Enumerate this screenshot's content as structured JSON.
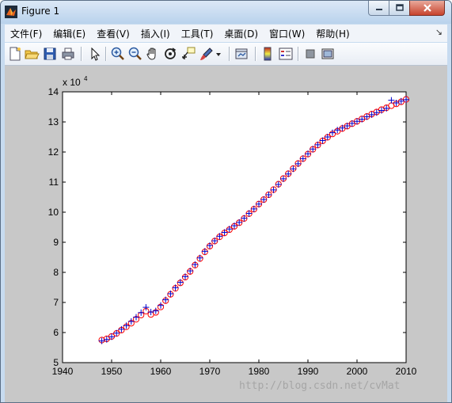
{
  "window": {
    "title": "Figure 1"
  },
  "menu": [
    "文件(F)",
    "编辑(E)",
    "查看(V)",
    "插入(I)",
    "工具(T)",
    "桌面(D)",
    "窗口(W)",
    "帮助(H)"
  ],
  "toolbar": {
    "items": [
      "new-figure-icon",
      "open-file-icon",
      "save-icon",
      "print-icon",
      "pointer-icon",
      "zoom-in-icon",
      "zoom-out-icon",
      "pan-hand-icon",
      "rotate-3d-icon",
      "data-cursor-icon",
      "brush-icon",
      "link-plot-icon",
      "colorbar-icon",
      "legend-icon",
      "hide-plot-tools-icon",
      "show-plot-tools-icon"
    ]
  },
  "colors": {
    "axes_background": "#ffffff",
    "figure_background": "#c8c8c8",
    "series_red": "#ff0000",
    "series_blue": "#0000cc"
  },
  "watermark": "http://blog.csdn.net/cvMat",
  "chart_data": {
    "type": "scatter",
    "title": "",
    "xlabel": "",
    "ylabel": "",
    "xlim": [
      1940,
      2010
    ],
    "ylim": [
      5,
      14
    ],
    "y_exponent_label": "x 10",
    "y_exponent_power": "4",
    "xticks": [
      1940,
      1950,
      1960,
      1970,
      1980,
      1990,
      2000,
      2010
    ],
    "yticks": [
      5,
      6,
      7,
      8,
      9,
      10,
      11,
      12,
      13,
      14
    ],
    "grid": false,
    "legend": "none",
    "x": [
      1948,
      1949,
      1950,
      1951,
      1952,
      1953,
      1954,
      1955,
      1956,
      1957,
      1958,
      1959,
      1960,
      1961,
      1962,
      1963,
      1964,
      1965,
      1966,
      1967,
      1968,
      1969,
      1970,
      1971,
      1972,
      1973,
      1974,
      1975,
      1976,
      1977,
      1978,
      1979,
      1980,
      1981,
      1982,
      1983,
      1984,
      1985,
      1986,
      1987,
      1988,
      1989,
      1990,
      1991,
      1992,
      1993,
      1994,
      1995,
      1996,
      1997,
      1998,
      1999,
      2000,
      2001,
      2002,
      2003,
      2004,
      2005,
      2006,
      2007,
      2008,
      2009,
      2010
    ],
    "series": [
      {
        "marker": "o",
        "color": "#ff0000",
        "values": [
          5.75,
          5.79,
          5.87,
          5.97,
          6.08,
          6.19,
          6.31,
          6.44,
          6.58,
          6.71,
          6.6,
          6.67,
          6.85,
          7.06,
          7.27,
          7.47,
          7.65,
          7.84,
          8.03,
          8.24,
          8.46,
          8.68,
          8.87,
          9.04,
          9.18,
          9.31,
          9.42,
          9.53,
          9.65,
          9.79,
          9.95,
          10.1,
          10.27,
          10.42,
          10.58,
          10.75,
          10.93,
          11.12,
          11.28,
          11.45,
          11.62,
          11.78,
          11.93,
          12.09,
          12.23,
          12.37,
          12.49,
          12.6,
          12.69,
          12.78,
          12.86,
          12.94,
          13.02,
          13.1,
          13.18,
          13.26,
          13.33,
          13.41,
          13.47,
          13.54,
          13.6,
          13.67,
          13.75
        ]
      },
      {
        "marker": "+",
        "color": "#0000cc",
        "values": [
          5.72,
          5.77,
          5.86,
          5.98,
          6.11,
          6.23,
          6.37,
          6.51,
          6.66,
          6.84,
          6.68,
          6.72,
          6.9,
          7.09,
          7.29,
          7.49,
          7.67,
          7.86,
          8.05,
          8.26,
          8.48,
          8.7,
          8.89,
          9.05,
          9.2,
          9.33,
          9.44,
          9.55,
          9.66,
          9.8,
          9.96,
          10.11,
          10.27,
          10.42,
          10.58,
          10.74,
          10.92,
          11.11,
          11.27,
          11.44,
          11.61,
          11.78,
          11.94,
          12.1,
          12.24,
          12.38,
          12.5,
          12.64,
          12.73,
          12.8,
          12.87,
          12.95,
          13.02,
          13.09,
          13.17,
          13.24,
          13.31,
          13.38,
          13.45,
          13.72,
          13.63,
          13.69,
          13.74
        ]
      }
    ]
  }
}
